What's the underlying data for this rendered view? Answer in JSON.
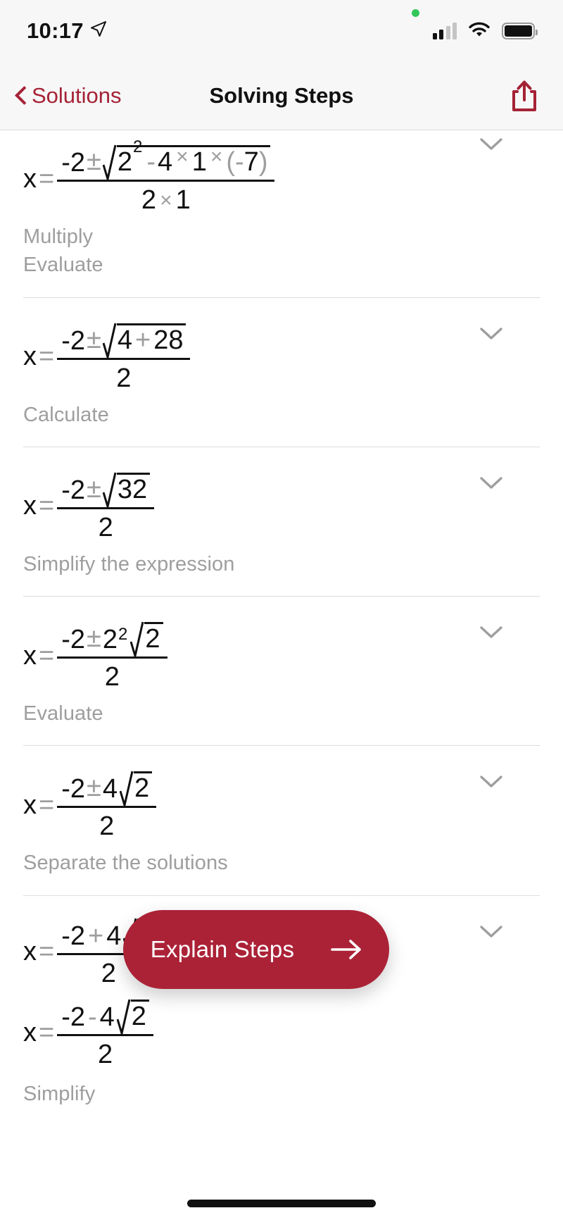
{
  "status_bar": {
    "time": "10:17",
    "location_icon": "location-arrow-icon",
    "recording_dot": "green-privacy-dot",
    "cellular_icon": "cellular-bars-icon",
    "wifi_icon": "wifi-icon",
    "battery_icon": "battery-full-icon"
  },
  "nav": {
    "back_label": "Solutions",
    "title": "Solving Steps",
    "share_icon": "share-icon",
    "back_icon": "chevron-left-icon"
  },
  "colors": {
    "accent_red": "#a52236",
    "button_red": "#ab2237",
    "label_gray": "#9e9e9e",
    "divider": "#dedede",
    "bar_bg": "#f7f7f7"
  },
  "steps": [
    {
      "id": "step-1",
      "expand_icon": "chevron-down-icon",
      "formula_text": "x = (-2 ± √(2² - 4×1×(-7))) / (2×1)",
      "labels": [
        "Multiply",
        "Evaluate"
      ]
    },
    {
      "id": "step-2",
      "expand_icon": "chevron-down-icon",
      "formula_text": "x = (-2 ± √(4 + 28)) / 2",
      "labels": [
        "Calculate"
      ]
    },
    {
      "id": "step-3",
      "expand_icon": "chevron-down-icon",
      "formula_text": "x = (-2 ± √32) / 2",
      "labels": [
        "Simplify the expression"
      ]
    },
    {
      "id": "step-4",
      "expand_icon": "chevron-down-icon",
      "formula_text": "x = (-2 ± 2²√2) / 2",
      "labels": [
        "Evaluate"
      ]
    },
    {
      "id": "step-5",
      "expand_icon": "chevron-down-icon",
      "formula_text": "x = (-2 ± 4√2) / 2",
      "labels": [
        "Separate the solutions"
      ]
    },
    {
      "id": "step-6",
      "expand_icon": "chevron-down-icon",
      "formula_text": "x = (-2 + 4√2) / 2 ; x = (-2 - 4√2) / 2",
      "labels": [
        "Simplify"
      ]
    }
  ],
  "math_tokens": {
    "x": "x",
    "equals": "=",
    "minus": "-",
    "plus": "+",
    "plusminus": "±",
    "times": "×",
    "two": "2",
    "four": "4",
    "one": "1",
    "seven": "7",
    "twentyeight": "28",
    "thirtytwo": "32",
    "lparen": "(",
    "rparen": ")",
    "sup_two": "2"
  },
  "explain_button": {
    "label": "Explain Steps",
    "icon": "arrow-right-icon"
  },
  "home_indicator": "home-indicator"
}
